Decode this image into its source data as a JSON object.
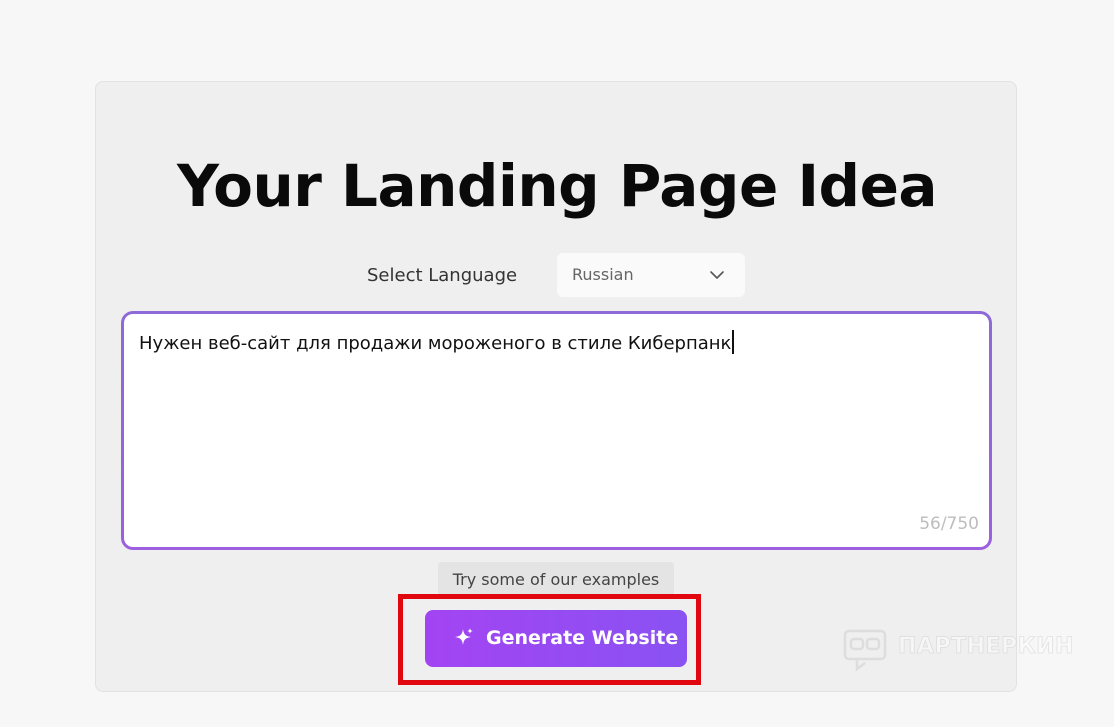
{
  "main": {
    "title": "Your Landing Page Idea",
    "language_label": "Select Language",
    "language_selected": "Russian",
    "idea_text": "Нужен веб-сайт для продажи мороженого в стиле Киберпанк",
    "char_counter": "56/750",
    "examples_button": "Try some of our examples",
    "generate_button": "Generate Website"
  },
  "watermark": {
    "text": "ПАРТНЕРКИН",
    "icon": "vr-headset-icon"
  },
  "colors": {
    "accent_purple": "#9b5fe0",
    "button_gradient_start": "#a344f2",
    "button_gradient_end": "#8a52f2",
    "highlight_red": "#e0080e"
  }
}
